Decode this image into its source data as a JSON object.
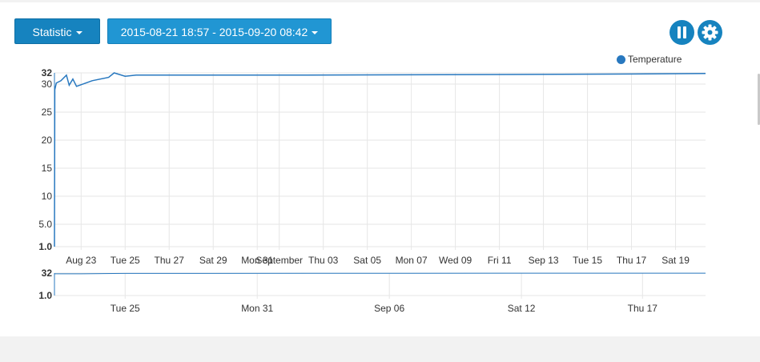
{
  "toolbar": {
    "statistic_label": "Statistic",
    "range_label": "2015-08-21 18:57 - 2015-09-20 08:42",
    "pause_icon": "pause-icon",
    "settings_icon": "gear-icon"
  },
  "colors": {
    "accent": "#1683bf",
    "series_line": "#2878bf",
    "grid": "#e6e6e6"
  },
  "chart_data": [
    {
      "type": "line",
      "title": "",
      "xlabel": "",
      "ylabel": "",
      "y_ticks": [
        "32",
        "30",
        "25",
        "20",
        "15",
        "10",
        "5.0",
        "1.0"
      ],
      "x_ticks": [
        "Aug 23",
        "Tue 25",
        "Thu 27",
        "Sat 29",
        "Mon 31",
        "September",
        "Thu 03",
        "Sat 05",
        "Mon 07",
        "Wed 09",
        "Fri 11",
        "Sep 13",
        "Tue 15",
        "Thu 17",
        "Sat 19"
      ],
      "ylim": [
        1,
        32
      ],
      "legend": "top-right",
      "grid": true,
      "series": [
        {
          "name": "Temperature",
          "points": [
            [
              "2015-08-21 18:57",
              1.0
            ],
            [
              "2015-08-21 19:20",
              29.0
            ],
            [
              "2015-08-21 21:00",
              30.2
            ],
            [
              "2015-08-22 02:00",
              30.6
            ],
            [
              "2015-08-22 08:00",
              31.6
            ],
            [
              "2015-08-22 11:00",
              29.8
            ],
            [
              "2015-08-22 15:00",
              30.9
            ],
            [
              "2015-08-22 19:00",
              29.6
            ],
            [
              "2015-08-23 12:00",
              30.6
            ],
            [
              "2015-08-24 06:00",
              31.2
            ],
            [
              "2015-08-24 12:00",
              32.0
            ],
            [
              "2015-08-25 00:00",
              31.4
            ],
            [
              "2015-08-25 12:00",
              31.6
            ],
            [
              "2015-09-01 00:00",
              31.6
            ],
            [
              "2015-09-10 00:00",
              31.7
            ],
            [
              "2015-09-17 00:00",
              31.8
            ],
            [
              "2015-09-20 08:42",
              31.9
            ]
          ]
        }
      ]
    },
    {
      "type": "line",
      "title": "",
      "xlabel": "",
      "ylabel": "",
      "y_ticks": [
        "32",
        "1.0"
      ],
      "x_ticks": [
        "Tue 25",
        "Mon 31",
        "Sep 06",
        "Sat 12",
        "Thu 17"
      ],
      "ylim": [
        1,
        32
      ],
      "grid": true,
      "series": [
        {
          "name": "Temperature",
          "points": [
            [
              "2015-08-21 18:57",
              31.0
            ],
            [
              "2015-08-23 00:00",
              31.0
            ],
            [
              "2015-08-25 00:00",
              31.6
            ],
            [
              "2015-09-20 08:42",
              31.9
            ]
          ]
        }
      ]
    }
  ]
}
